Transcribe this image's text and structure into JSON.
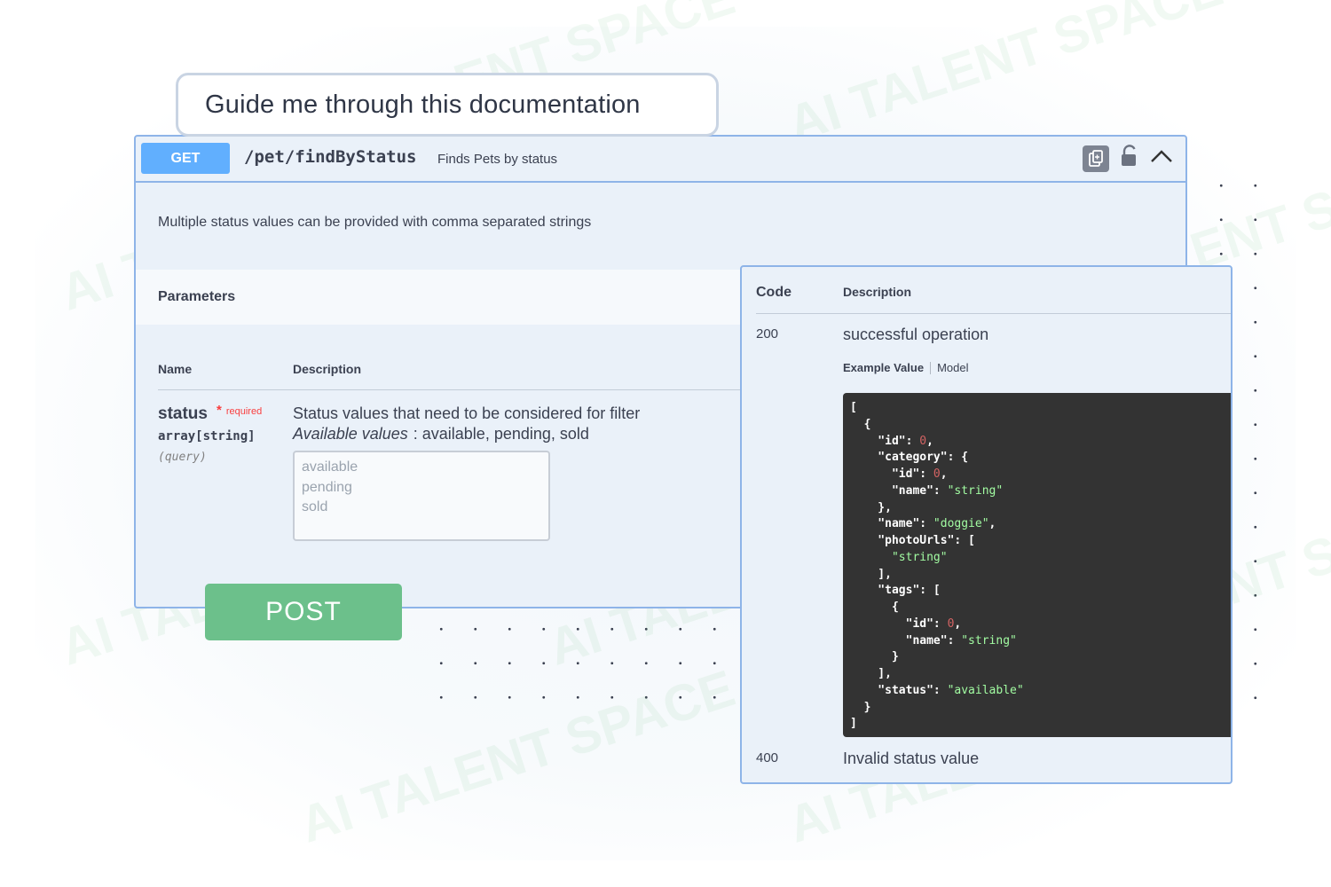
{
  "prompt": {
    "text": "Guide me through this documentation"
  },
  "operation": {
    "method": "GET",
    "path": "/pet/findByStatus",
    "summary": "Finds Pets by status",
    "description": "Multiple status values can be provided with comma separated strings"
  },
  "parameters": {
    "section_title": "Parameters",
    "col_name": "Name",
    "col_description": "Description",
    "param": {
      "name": "status",
      "required_label": "required",
      "type": "array[string]",
      "location": "(query)",
      "description": "Status values that need to be considered for filter",
      "available_label": "Available values",
      "available_values": ": available, pending, sold",
      "options": [
        "available",
        "pending",
        "sold"
      ]
    }
  },
  "post_button": {
    "label": "POST",
    "color": "#6cc08b"
  },
  "responses": {
    "col_code": "Code",
    "col_description": "Description",
    "items": [
      {
        "code": "200",
        "description": "successful operation"
      },
      {
        "code": "400",
        "description": "Invalid status value"
      }
    ],
    "example_tab": "Example Value",
    "model_tab": "Model"
  },
  "colors": {
    "get": "#61affe",
    "border": "#8eb4e8",
    "panel_bg": "#eaf1f9",
    "required": "#f93e3e"
  },
  "watermark": "AI TALENT SPACE"
}
